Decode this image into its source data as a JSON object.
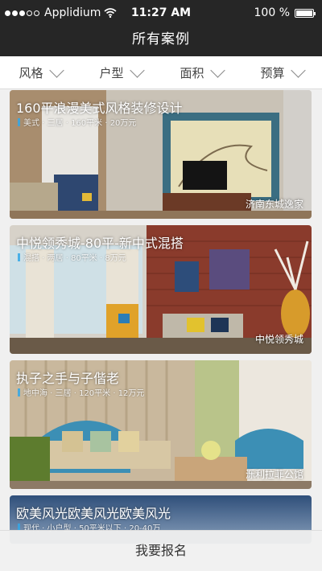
{
  "status": {
    "carrier": "Applidium",
    "time": "11:27 AM",
    "battery": "100 %",
    "signal_dots_filled": 3,
    "signal_dots_total": 5
  },
  "nav": {
    "title": "所有案例"
  },
  "filters": [
    {
      "label": "风格"
    },
    {
      "label": "户型"
    },
    {
      "label": "面积"
    },
    {
      "label": "预算"
    }
  ],
  "cases": [
    {
      "title": "160平浪漫美式风格装修设计",
      "tags": "美式 · 三居 · 160平米 · 20万元",
      "location": "济南东城逸家"
    },
    {
      "title": "中悦领秀城-80平-新中式混搭",
      "tags": "混搭 · 两居 · 80平米 · 8万元",
      "location": "中悦领秀城"
    },
    {
      "title": "执子之手与子偕老",
      "tags": "地中海 · 三居 · 120平米 · 12万元",
      "location": "泺利拉菲公馆"
    },
    {
      "title": "欧美风光欧美风光欧美风光",
      "tags": "现代 · 小户型 · 50平米以下 · 20-40万",
      "location": ""
    }
  ],
  "bottom": {
    "label": "我要报名"
  },
  "colors": {
    "bar": "#262626",
    "accent": "#33a8e8"
  }
}
